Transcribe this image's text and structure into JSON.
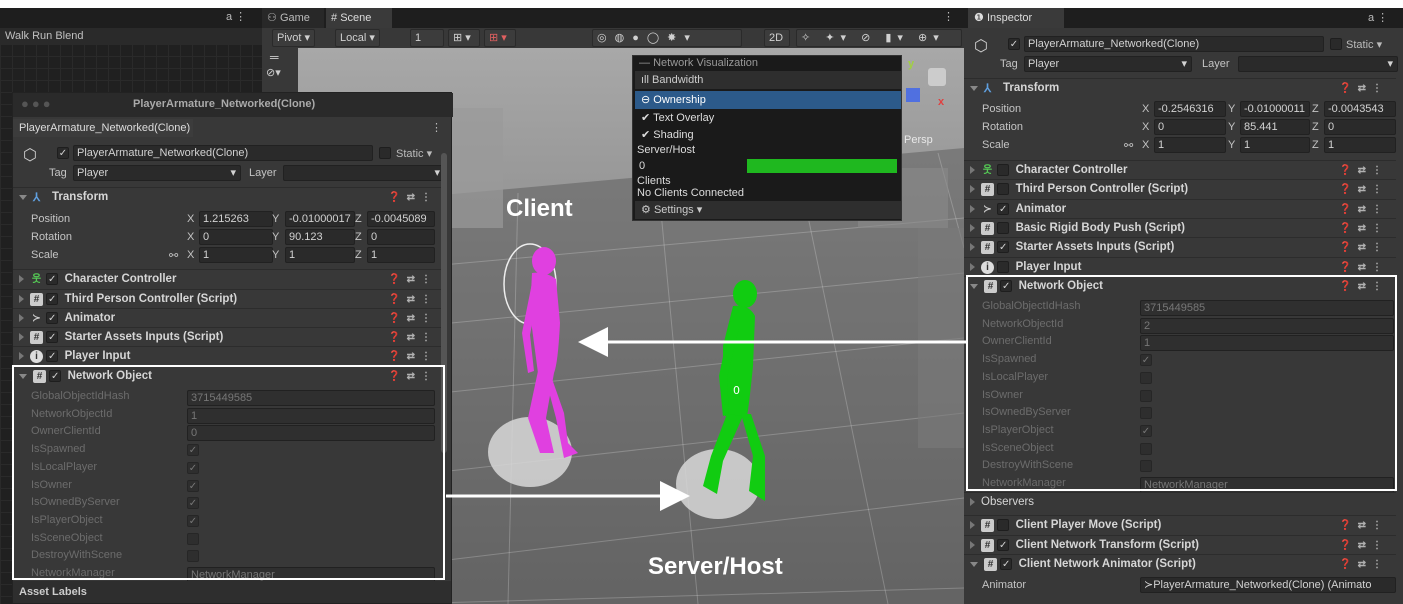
{
  "top": {
    "walk_run_blend": "Walk Run Blend",
    "tab_game": "Game",
    "tab_scene": "Scene",
    "pivot": "Pivot",
    "local": "Local",
    "grid_value": "1",
    "btn_2d": "2D",
    "persp": "Persp"
  },
  "netvis": {
    "title": "Network Visualization",
    "bandwidth": "Bandwidth",
    "ownership": "Ownership",
    "text_overlay": "Text Overlay",
    "shading": "Shading",
    "server_host": "Server/Host",
    "server_value": "0",
    "clients": "Clients",
    "no_clients": "No Clients Connected",
    "settings": "Settings",
    "bar_color": "#1fb81f"
  },
  "scene": {
    "client_label": "Client",
    "server_label": "Server/Host",
    "client_color": "#e040e0",
    "server_color": "#11cc11",
    "owner_marker": "0"
  },
  "left": {
    "window_title": "PlayerArmature_Networked(Clone)",
    "tab": "PlayerArmature_Networked(Clone)",
    "object_name": "PlayerArmature_Networked(Clone)",
    "static": "Static",
    "tag_label": "Tag",
    "tag_value": "Player",
    "layer_label": "Layer",
    "transform": "Transform",
    "position_label": "Position",
    "rotation_label": "Rotation",
    "scale_label": "Scale",
    "pos": [
      "1.215263",
      "-0.01000017",
      "-0.0045089"
    ],
    "rot": [
      "0",
      "90.123",
      "0"
    ],
    "scl": [
      "1",
      "1",
      "1"
    ],
    "components": [
      "Character Controller",
      "Third Person Controller (Script)",
      "Animator",
      "Starter Assets Inputs (Script)",
      "Player Input"
    ],
    "network_object": "Network Object",
    "props": [
      {
        "name": "GlobalObjectIdHash",
        "value": "3715449585"
      },
      {
        "name": "NetworkObjectId",
        "value": "1"
      },
      {
        "name": "OwnerClientId",
        "value": "0"
      },
      {
        "name": "IsSpawned",
        "value": "✓"
      },
      {
        "name": "IsLocalPlayer",
        "value": "✓"
      },
      {
        "name": "IsOwner",
        "value": "✓"
      },
      {
        "name": "IsOwnedByServer",
        "value": "✓"
      },
      {
        "name": "IsPlayerObject",
        "value": "✓"
      },
      {
        "name": "IsSceneObject",
        "value": ""
      },
      {
        "name": "DestroyWithScene",
        "value": ""
      },
      {
        "name": "NetworkManager",
        "value": "NetworkManager"
      }
    ],
    "asset_labels": "Asset Labels"
  },
  "right": {
    "tab": "Inspector",
    "object_name": "PlayerArmature_Networked(Clone)",
    "static": "Static",
    "tag_label": "Tag",
    "tag_value": "Player",
    "layer_label": "Layer",
    "transform": "Transform",
    "position_label": "Position",
    "rotation_label": "Rotation",
    "scale_label": "Scale",
    "pos": [
      "-0.2546316",
      "-0.01000011",
      "-0.0043543"
    ],
    "rot": [
      "0",
      "85.441",
      "0"
    ],
    "scl": [
      "1",
      "1",
      "1"
    ],
    "components": [
      "Character Controller",
      "Third Person Controller (Script)",
      "Animator",
      "Basic Rigid Body Push (Script)",
      "Starter Assets Inputs (Script)",
      "Player Input"
    ],
    "network_object": "Network Object",
    "props": [
      {
        "name": "GlobalObjectIdHash",
        "value": "3715449585"
      },
      {
        "name": "NetworkObjectId",
        "value": "2"
      },
      {
        "name": "OwnerClientId",
        "value": "1"
      },
      {
        "name": "IsSpawned",
        "value": "✓"
      },
      {
        "name": "IsLocalPlayer",
        "value": ""
      },
      {
        "name": "IsOwner",
        "value": ""
      },
      {
        "name": "IsOwnedByServer",
        "value": ""
      },
      {
        "name": "IsPlayerObject",
        "value": "✓"
      },
      {
        "name": "IsSceneObject",
        "value": ""
      },
      {
        "name": "DestroyWithScene",
        "value": ""
      },
      {
        "name": "NetworkManager",
        "value": "NetworkManager"
      }
    ],
    "observers": "Observers",
    "extra_components": [
      "Client Player Move (Script)",
      "Client Network Transform (Script)",
      "Client Network Animator (Script)"
    ],
    "animator_label": "Animator",
    "animator_value": "PlayerArmature_Networked(Clone) (Animato"
  }
}
